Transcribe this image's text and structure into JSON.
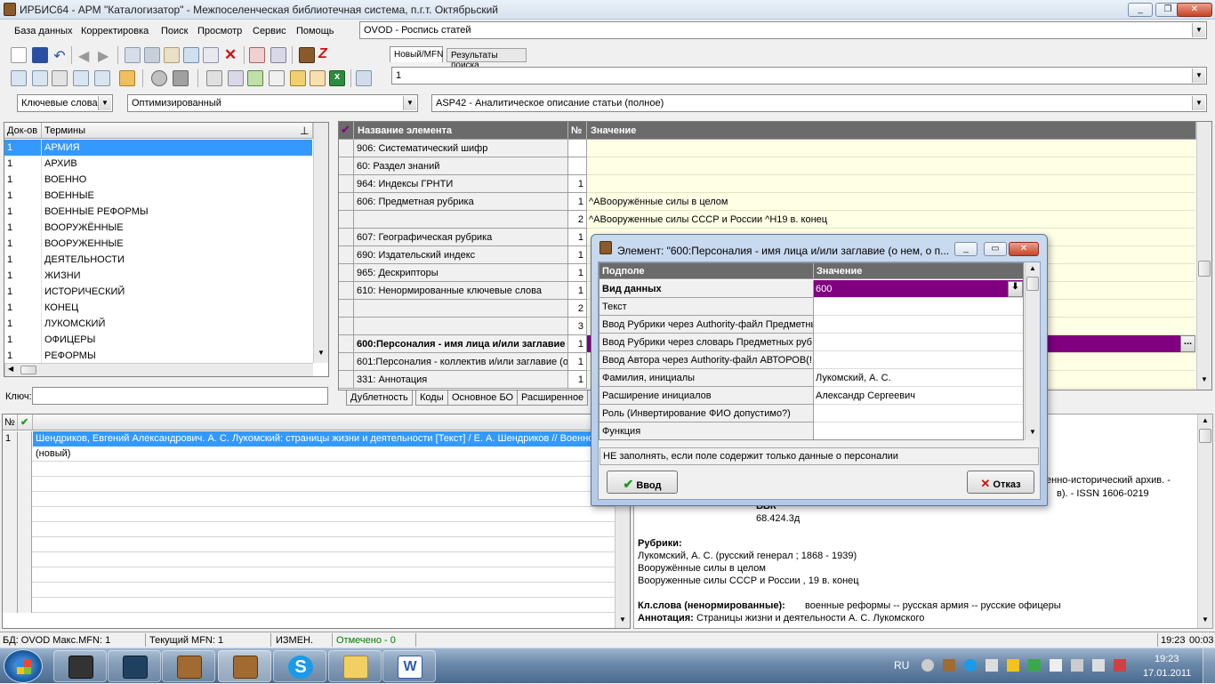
{
  "window": {
    "title": "ИРБИС64 - АРМ \"Каталогизатор\" - Межпоселенческая библиотечная система,  п.г.т. Октябрьский",
    "minimize": "0",
    "maximize": "1",
    "close": "r"
  },
  "menu": {
    "items": [
      "База данных",
      "Корректировка",
      "Поиск",
      "Просмотр",
      "Сервис",
      "Помощь"
    ]
  },
  "database_combo": {
    "value": "OVOD - Роспись  статей"
  },
  "search_tabs": [
    "Новый/MFN",
    "Результаты поиска"
  ],
  "mfn_combo": {
    "value": "1"
  },
  "filters": {
    "index": "Ключевые слова",
    "mode": "Оптимизированный",
    "worksheet": "ASP42 - Аналитическое описание статьи (полное)"
  },
  "dictionary": {
    "col_docs": "Док-ов",
    "col_terms": "Термины",
    "pin": "Ţ",
    "rows": [
      {
        "count": "1",
        "term": "АРМИЯ"
      },
      {
        "count": "1",
        "term": "АРХИВ"
      },
      {
        "count": "1",
        "term": "ВОЕННО"
      },
      {
        "count": "1",
        "term": "ВОЕННЫЕ"
      },
      {
        "count": "1",
        "term": "ВОЕННЫЕ РЕФОРМЫ"
      },
      {
        "count": "1",
        "term": "ВООРУЖЁННЫЕ"
      },
      {
        "count": "1",
        "term": "ВООРУЖЕННЫЕ"
      },
      {
        "count": "1",
        "term": "ДЕЯТЕЛЬНОСТИ"
      },
      {
        "count": "1",
        "term": "ЖИЗНИ"
      },
      {
        "count": "1",
        "term": "ИСТОРИЧЕСКИЙ"
      },
      {
        "count": "1",
        "term": "КОНЕЦ"
      },
      {
        "count": "1",
        "term": "ЛУКОМСКИЙ"
      },
      {
        "count": "1",
        "term": "ОФИЦЕРЫ"
      },
      {
        "count": "1",
        "term": "РЕФОРМЫ"
      }
    ],
    "key_label": "Ключ:",
    "key_value": ""
  },
  "elements": {
    "col_check": "✔",
    "col_name": "Название элемента",
    "col_num": "№",
    "col_value": "Значение",
    "rows": [
      {
        "name": "906: Систематический шифр",
        "num": "",
        "value": ""
      },
      {
        "name": "60: Раздел знаний",
        "num": "",
        "value": ""
      },
      {
        "name": "964: Индексы ГРНТИ",
        "num": "1",
        "value": ""
      },
      {
        "name": "606: Предметная рубрика",
        "num": "1",
        "value": "^AВооружённые силы в целом"
      },
      {
        "name": "",
        "num": "2",
        "value": "^AВооруженные силы СССР и России ^H19 в. конец"
      },
      {
        "name": "607: Географическая рубрика",
        "num": "1",
        "value": ""
      },
      {
        "name": "690: Издательский индекс",
        "num": "1",
        "value": ""
      },
      {
        "name": "965: Дескрипторы",
        "num": "1",
        "value": ""
      },
      {
        "name": "610: Ненормированные ключевые слова",
        "num": "1",
        "value": ""
      },
      {
        "name": "",
        "num": "2",
        "value": ""
      },
      {
        "name": "",
        "num": "3",
        "value": ""
      },
      {
        "name": "600:Персоналия - имя лица и/или заглавие",
        "num": "1",
        "value": ""
      },
      {
        "name": "601:Персоналия - коллектив и/или заглавие (о",
        "num": "1",
        "value": ""
      },
      {
        "name": "331: Аннотация",
        "num": "1",
        "value": ""
      }
    ],
    "ellipsis": "...",
    "tabs": [
      "Дублетность",
      "Коды",
      "Основное БО",
      "Расширенное"
    ]
  },
  "records": {
    "col_num": "№",
    "col_mark": "✔",
    "rows": [
      {
        "num": "1",
        "text": "Шендриков, Евгений Александрович. А. С. Лукомский: страницы жизни и деятельности [Текст] / Е. А. Шендриков // Военно-исторический архив. - 2010. - № 11. - С. 3-24. - ISSN 1606-0219"
      },
      {
        "num": "",
        "text": "(новый)"
      }
    ]
  },
  "description": {
    "line1": "енно-исторический архив. -",
    "line2": "в). - ISSN 1606-0219",
    "bbk_label": "ББК",
    "bbk_value": "68.424.3д",
    "rubrics_label": "Рубрики:",
    "rubrics": [
      "Лукомский, А. С. (русский генерал ; 1868 - 1939)",
      "Вооружённые силы в целом",
      "Вооруженные силы СССР и России , 19 в. конец"
    ],
    "keywords_label": "Кл.слова (ненормированные):",
    "keywords": "военные реформы -- русская армия -- русские офицеры",
    "annotation_label": "Аннотация:",
    "annotation": "Страницы жизни и деятельности А. С. Лукомского"
  },
  "dialog": {
    "title": "Элемент: \"600:Персоналия - имя лица и/или заглавие  (о нем, о п...",
    "col_subfield": "Подполе",
    "col_value": "Значение",
    "rows": [
      {
        "key": "Вид данных",
        "value": "600"
      },
      {
        "key": "Текст",
        "value": ""
      },
      {
        "key": "Ввод Рубрики через Authority-файл Предметны",
        "value": ""
      },
      {
        "key": "Ввод Рубрики через словарь Предметных руб",
        "value": ""
      },
      {
        "key": "Ввод Автора через Authority-файл АВТОРОВ(!",
        "value": ""
      },
      {
        "key": "Фамилия, инициалы",
        "value": "Лукомский, А. С."
      },
      {
        "key": "Расширение инициалов",
        "value": "Александр Сергеевич"
      },
      {
        "key": "Роль (Инвертирование ФИО допустимо?)",
        "value": ""
      },
      {
        "key": "Функция",
        "value": ""
      }
    ],
    "hint": "НЕ заполнять, если поле содержит только данные о персоналии",
    "ok_label": "Ввод",
    "cancel_label": "Отказ"
  },
  "status": {
    "db": "БД: OVOD Макс.MFN: 1",
    "current_mfn": "Текущий MFN: 1",
    "changed": "ИЗМЕН.",
    "marked": "Отмечено - 0",
    "time1": "19:23",
    "time2": "00:03"
  },
  "taskbar": {
    "lang": "RU",
    "clock_time": "19:23",
    "clock_date": "17.01.2011",
    "apps": [
      "media-player-classic",
      "kmplayer",
      "irbis",
      "irbis-active",
      "skype",
      "file-explorer",
      "word"
    ]
  },
  "colors": {
    "selection": "#3399ff",
    "active_row": "#800080",
    "value_bg": "#ffffe6",
    "marked_text": "#008000"
  }
}
